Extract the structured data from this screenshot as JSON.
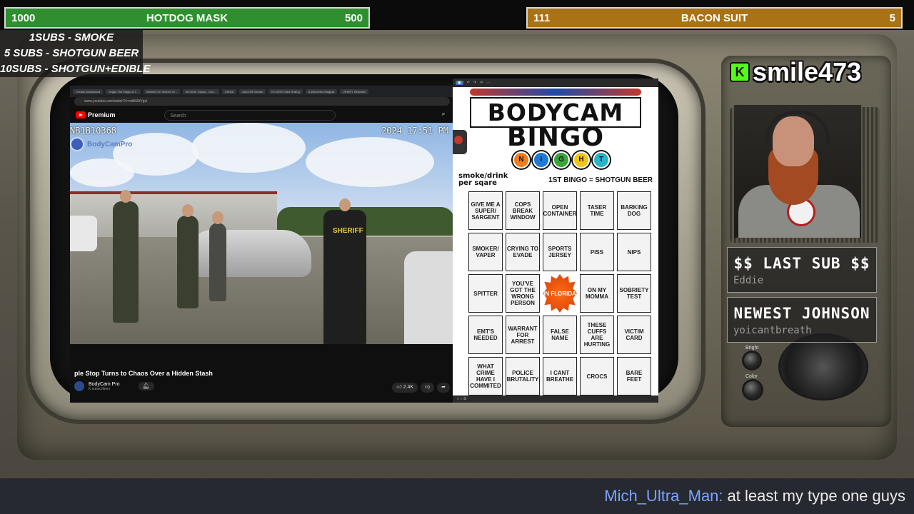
{
  "goals": {
    "left": {
      "start": "1000",
      "name": "HOTDOG MASK",
      "end": "500"
    },
    "right": {
      "start": "111",
      "name": "BACON SUIT",
      "end": "5"
    }
  },
  "rules": [
    "1SUBS   - SMOKE",
    "5 SUBS  - SHOTGUN BEER",
    "10SUBS - SHOTGUN+EDIBLE"
  ],
  "browser": {
    "tabs": [
      "Creator Dashboard",
      "Vegan The magic of t...",
      "Marbles On Stream Vi...",
      "All Other Tracks - Goo...",
      "GitHub",
      "AlexC99 Stream",
      "ECORNY East Rolling",
      "A Wonderful Magical",
      "VERIFY Repeater"
    ],
    "url": "www.youtube.com/watch?v=xdh5IbVgxl",
    "yt_brand": "Premium",
    "search_placeholder": "Search",
    "cam_id": "NB1B10368",
    "cam_date": "2024   17:51 PM",
    "watermark": "BodyCamPro",
    "sheriff_label": "SHERIFF",
    "video_title": "ple Stop Turns to Chaos Over a Hidden Stash",
    "channel_name": "BodyCam Pro",
    "channel_subs": "K subscribers",
    "likes": "2.4K"
  },
  "bingo": {
    "title_line1": "BODYCAM",
    "title_line2": "BINGO",
    "night_letters": [
      "N",
      "I",
      "G",
      "H",
      "T"
    ],
    "night_colors": [
      "#f07c1e",
      "#1f7ad6",
      "#3aa53a",
      "#f2c519",
      "#2ab3c9"
    ],
    "sub_left_1": "smoke/drink",
    "sub_left_2": "per sqare",
    "sub_right": "1ST BINGO = SHOTGUN BEER",
    "cells": [
      "GIVE ME A SUPER/ SARGENT",
      "COPS BREAK WINDOW",
      "OPEN CONTAINER",
      "TASER TIME",
      "BARKING DOG",
      "SMOKER/ VAPER",
      "CRYING TO EVADE",
      "SPORTS JERSEY",
      "PISS",
      "NIPS",
      "SPITTER",
      "YOU'VE GOT THE WRONG PERSON",
      "IN FLORIDA",
      "ON MY MOMMA",
      "SOBRIETY TEST",
      "EMT'S NEEDED",
      "WARRANT FOR ARREST",
      "FALSE NAME",
      "THESE CUFFS ARE HURTING",
      "VICTIM CARD",
      "WHAT CRIME HAVE I COMMITED",
      "POLICE BRUTALITY",
      "I CANT BREATHE",
      "CROCS",
      "BARE FEET"
    ]
  },
  "streamer": {
    "platform_badge": "K",
    "username": "smile473"
  },
  "last_sub": {
    "title": "$$ LAST SUB $$",
    "value": "Eddie"
  },
  "newest": {
    "title": "NEWEST JOHNSON",
    "value": "yoicantbreath"
  },
  "knob_labels": [
    "Bright",
    "Color"
  ],
  "chat": {
    "user": "Mich_Ultra_Man:",
    "message": "at least my type one guys"
  }
}
